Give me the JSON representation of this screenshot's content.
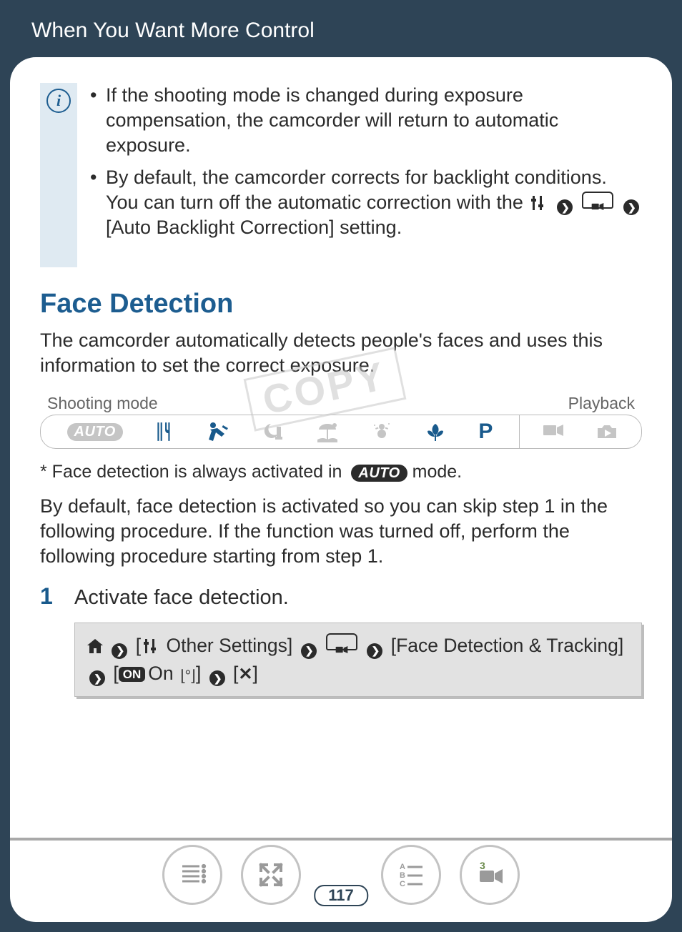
{
  "header": {
    "title": "When You Want More Control"
  },
  "info": {
    "bullets": [
      "If the shooting mode is changed during exposure compensation, the camcorder will return to automatic exposure.",
      "By default, the camcorder corrects for backlight conditions. You can turn off the automatic correction with the"
    ],
    "tail_setting": "[Auto Backlight Correction] setting."
  },
  "section": {
    "heading": "Face Detection",
    "intro": "The camcorder automatically detects people's faces and uses this information to set the correct exposure."
  },
  "modestrip": {
    "shoot_label": "Shooting mode",
    "play_label": "Playback",
    "auto_text": "AUTO",
    "p_text": "P"
  },
  "watermark": "COPY",
  "footnote": {
    "prefix": "*  Face detection is always activated in ",
    "suffix": " mode."
  },
  "para1": "By default, face detection is activated so you can skip step 1 in the following procedure. If the function was turned off, perform the following procedure starting from step 1.",
  "steps": [
    {
      "num": "1",
      "text": "Activate face detection."
    }
  ],
  "path": {
    "seg1": "Other Settings]",
    "seg2": "[Face Detection & Tracking]",
    "on_label": "ON",
    "on_text": "On"
  },
  "page_number": "117"
}
